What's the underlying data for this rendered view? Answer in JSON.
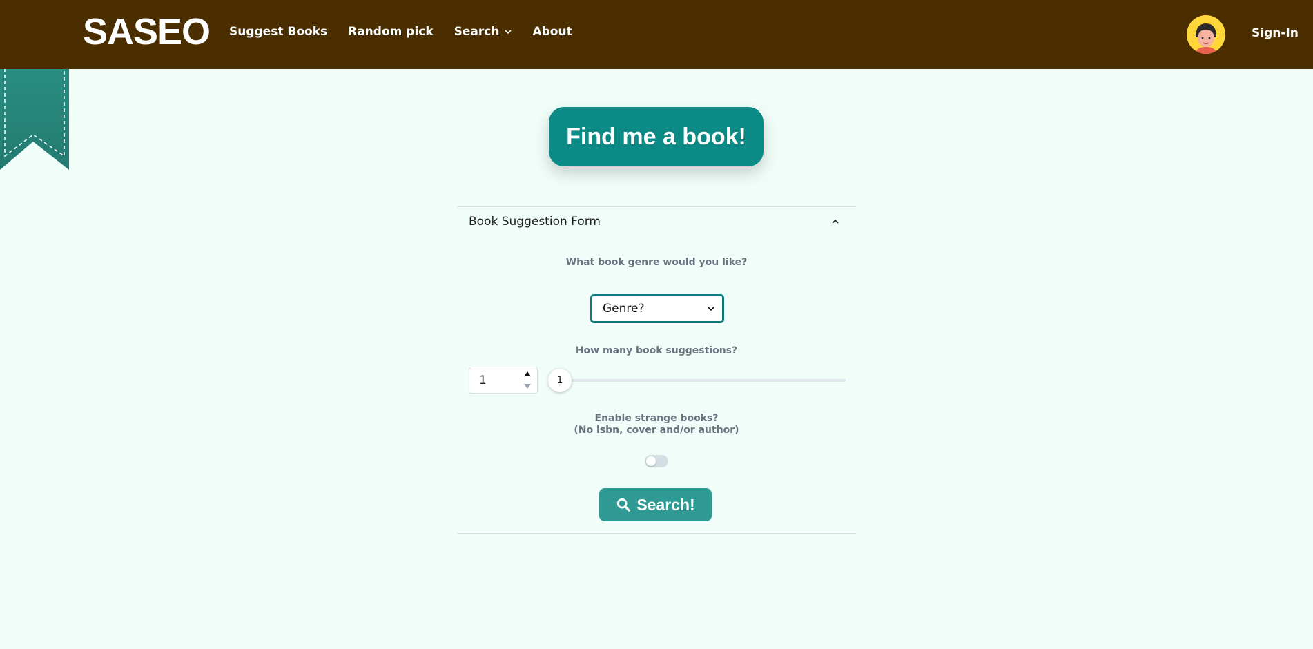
{
  "header": {
    "brand": "SASEO",
    "nav": [
      {
        "label": "Suggest Books"
      },
      {
        "label": "Random pick"
      },
      {
        "label": "Search",
        "has_dropdown": true
      },
      {
        "label": "About"
      }
    ],
    "signin_label": "Sign-In"
  },
  "main": {
    "find_button_label": "Find me a book!"
  },
  "form": {
    "title": "Book Suggestion Form",
    "genre_question": "What book genre would you like?",
    "genre_selected": "Genre?",
    "count_question": "How many book suggestions?",
    "count_value": "1",
    "slider_value": "1",
    "strange_question_line1": "Enable strange books?",
    "strange_question_line2": "(No isbn, cover and/or author)",
    "strange_enabled": false,
    "search_label": "Search!"
  },
  "colors": {
    "header_bg": "#4b2e00",
    "accent_teal": "#0b8a86",
    "search_button": "#2e9a93",
    "page_bg": "#f1fdf9",
    "ribbon": "#2a8f84"
  },
  "icons": {
    "nav_search_dropdown": "chevron-down-icon",
    "accordion_toggle": "chevron-up-icon",
    "select_arrow": "chevron-down-icon",
    "search_button": "magnifier-icon"
  }
}
